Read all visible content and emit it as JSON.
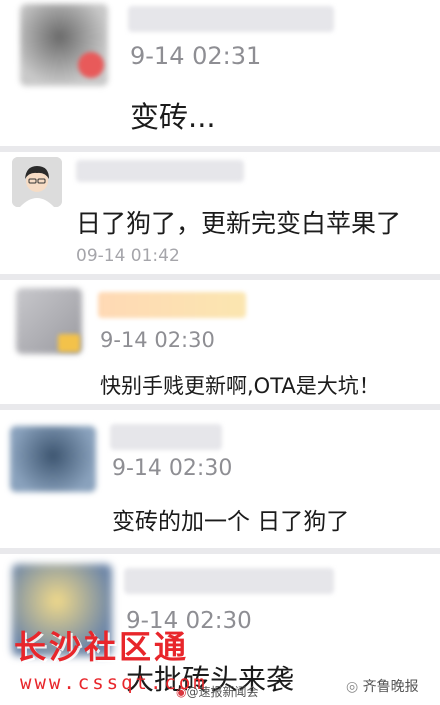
{
  "comments": [
    {
      "time": "9-14 02:31",
      "text": "变砖..."
    },
    {
      "time": "09-14 01:42",
      "text": "日了狗了，更新完变白苹果了"
    },
    {
      "time": "9-14 02:30",
      "text": "快别手贱更新啊,OTA是大坑！"
    },
    {
      "time": "9-14 02:30",
      "text": "变砖的加一个 日了狗了"
    },
    {
      "time": "9-14 02:30",
      "text": "大批砖头来袭"
    }
  ],
  "watermarks": {
    "site_name": "长沙社区通",
    "site_url": "www.cssqt.com",
    "weibo": "@速报新闻会",
    "wechat": "齐鲁晚报"
  },
  "colors": {
    "background": "#e9e9ec",
    "card": "#ffffff",
    "time": "#8e8e93",
    "watermark": "#e8262b"
  }
}
